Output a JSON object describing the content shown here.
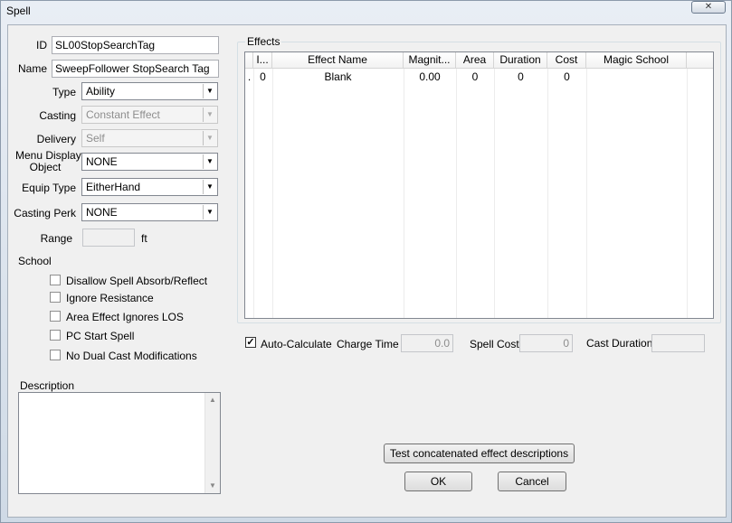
{
  "window": {
    "title": "Spell",
    "close_glyph": "✕"
  },
  "form": {
    "id_label": "ID",
    "id_value": "SL00StopSearchTag",
    "name_label": "Name",
    "name_value": "SweepFollower StopSearch Tag",
    "type_label": "Type",
    "type_value": "Ability",
    "casting_label": "Casting",
    "casting_value": "Constant Effect",
    "delivery_label": "Delivery",
    "delivery_value": "Self",
    "menu_display_label_1": "Menu Display",
    "menu_display_label_2": "Object",
    "menu_display_value": "NONE",
    "equip_type_label": "Equip Type",
    "equip_type_value": "EitherHand",
    "casting_perk_label": "Casting Perk",
    "casting_perk_value": "NONE",
    "range_label": "Range",
    "range_value": "",
    "range_unit": "ft",
    "school_label": "School",
    "checkboxes": [
      {
        "label": "Disallow Spell Absorb/Reflect",
        "checked": false
      },
      {
        "label": "Ignore Resistance",
        "checked": false
      },
      {
        "label": "Area Effect Ignores LOS",
        "checked": false
      },
      {
        "label": "PC Start Spell",
        "checked": false
      },
      {
        "label": "No Dual Cast Modifications",
        "checked": false
      }
    ],
    "description_label": "Description",
    "description_value": ""
  },
  "effects": {
    "group_label": "Effects",
    "columns": [
      "I...",
      "Effect Name",
      "Magnit...",
      "Area",
      "Duration",
      "Cost",
      "Magic School"
    ],
    "rows": [
      {
        "marker": ".",
        "index": "0",
        "name": "Blank",
        "magnitude": "0.00",
        "area": "0",
        "duration": "0",
        "cost": "0",
        "school": ""
      }
    ]
  },
  "costs": {
    "auto_calc_label": "Auto-Calculate",
    "auto_calc_checked": true,
    "charge_time_label": "Charge Time",
    "charge_time_value": "0.0",
    "spell_cost_label": "Spell Cost",
    "spell_cost_value": "0",
    "cast_duration_label": "Cast Duration",
    "cast_duration_value": ""
  },
  "buttons": {
    "test": "Test concatenated effect descriptions",
    "ok": "OK",
    "cancel": "Cancel"
  },
  "icons": {
    "combo_arrow": "▼",
    "scroll_up": "▲",
    "scroll_down": "▼",
    "checkmark": "✓"
  }
}
